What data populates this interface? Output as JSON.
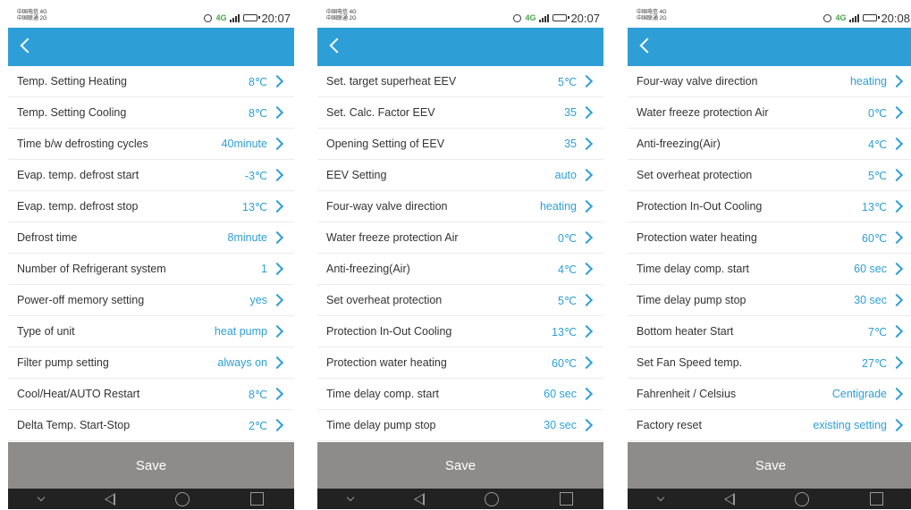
{
  "colors": {
    "accent": "#2e9fd6",
    "save_bg": "#8e8c8b",
    "nav_bg": "#222222"
  },
  "save_label": "Save",
  "phones": [
    {
      "status": {
        "carrier1": "中国电信 4G",
        "carrier2": "中国联通 2G",
        "net": "4G",
        "time": "20:07"
      },
      "rows": [
        {
          "label": "Temp. Setting Heating",
          "value": "8℃"
        },
        {
          "label": "Temp. Setting Cooling",
          "value": "8℃"
        },
        {
          "label": "Time b/w defrosting cycles",
          "value": "40minute"
        },
        {
          "label": "Evap. temp. defrost start",
          "value": "-3℃"
        },
        {
          "label": "Evap. temp. defrost stop",
          "value": "13℃"
        },
        {
          "label": "Defrost time",
          "value": "8minute"
        },
        {
          "label": "Number of Refrigerant system",
          "value": "1"
        },
        {
          "label": "Power-off memory setting",
          "value": "yes"
        },
        {
          "label": "Type of unit",
          "value": "heat pump"
        },
        {
          "label": "Filter pump setting",
          "value": "always on"
        },
        {
          "label": "Cool/Heat/AUTO Restart",
          "value": "8℃"
        },
        {
          "label": "Delta Temp. Start-Stop",
          "value": "2℃"
        }
      ]
    },
    {
      "status": {
        "carrier1": "中国电信 4G",
        "carrier2": "中国联通 2G",
        "net": "4G",
        "time": "20:07"
      },
      "rows": [
        {
          "label": "Set. target superheat EEV",
          "value": "5℃"
        },
        {
          "label": "Set. Calc. Factor EEV",
          "value": "35"
        },
        {
          "label": "Opening Setting of EEV",
          "value": "35"
        },
        {
          "label": "EEV Setting",
          "value": "auto"
        },
        {
          "label": "Four-way valve direction",
          "value": "heating"
        },
        {
          "label": "Water freeze protection Air",
          "value": "0℃"
        },
        {
          "label": "Anti-freezing(Air)",
          "value": "4℃"
        },
        {
          "label": "Set overheat protection",
          "value": "5℃"
        },
        {
          "label": "Protection In-Out Cooling",
          "value": "13℃"
        },
        {
          "label": "Protection water heating",
          "value": "60℃"
        },
        {
          "label": "Time delay comp. start",
          "value": "60 sec"
        },
        {
          "label": "Time delay pump stop",
          "value": "30 sec"
        }
      ]
    },
    {
      "status": {
        "carrier1": "中国电信 4G",
        "carrier2": "中国联通 2G",
        "net": "4G",
        "time": "20:08"
      },
      "rows": [
        {
          "label": "Four-way valve direction",
          "value": "heating"
        },
        {
          "label": "Water freeze protection Air",
          "value": "0℃"
        },
        {
          "label": "Anti-freezing(Air)",
          "value": "4℃"
        },
        {
          "label": "Set overheat protection",
          "value": "5℃"
        },
        {
          "label": "Protection In-Out Cooling",
          "value": "13℃"
        },
        {
          "label": "Protection water heating",
          "value": "60℃"
        },
        {
          "label": "Time delay comp. start",
          "value": "60 sec"
        },
        {
          "label": "Time delay pump stop",
          "value": "30 sec"
        },
        {
          "label": "Bottom heater Start",
          "value": "7℃"
        },
        {
          "label": "Set Fan Speed temp.",
          "value": "27℃"
        },
        {
          "label": "Fahrenheit / Celsius",
          "value": "Centigrade"
        },
        {
          "label": "Factory reset",
          "value": "existing setting"
        }
      ]
    }
  ]
}
